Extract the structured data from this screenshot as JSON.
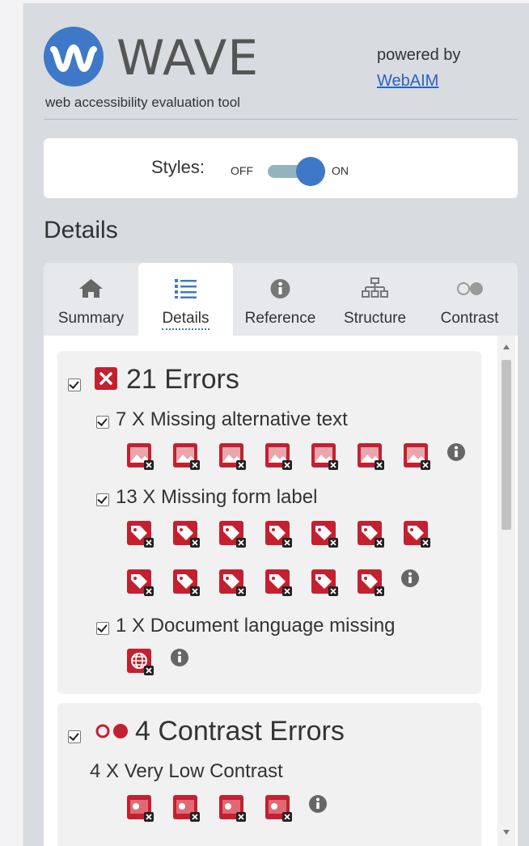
{
  "header": {
    "logo_text": "WAVE",
    "tagline": "web accessibility evaluation tool",
    "powered_by": "powered by",
    "webaim_link": "WebAIM"
  },
  "styles": {
    "label": "Styles:",
    "off": "OFF",
    "on": "ON",
    "state": "on"
  },
  "section_heading": "Details",
  "tabs": [
    {
      "label": "Summary",
      "icon": "home-icon",
      "active": false
    },
    {
      "label": "Details",
      "icon": "list-icon",
      "active": true
    },
    {
      "label": "Reference",
      "icon": "info-icon",
      "active": false
    },
    {
      "label": "Structure",
      "icon": "hierarchy-icon",
      "active": false
    },
    {
      "label": "Contrast",
      "icon": "contrast-icon",
      "active": false
    }
  ],
  "errors": {
    "title": "21 Errors",
    "groups": [
      {
        "label": "7 X Missing alternative text",
        "count": 7,
        "icon": "missing-alt-image-icon"
      },
      {
        "label": "13 X Missing form label",
        "count": 13,
        "icon": "missing-label-tag-icon"
      },
      {
        "label": "1 X Document language missing",
        "count": 1,
        "icon": "language-missing-globe-icon"
      }
    ]
  },
  "contrast": {
    "title": "4 Contrast Errors",
    "groups": [
      {
        "label": "4 X Very Low Contrast",
        "count": 4,
        "icon": "low-contrast-icon"
      }
    ]
  },
  "colors": {
    "brand_blue": "#3f78c6",
    "error_red": "#c4202f",
    "link": "#2a63c2"
  }
}
